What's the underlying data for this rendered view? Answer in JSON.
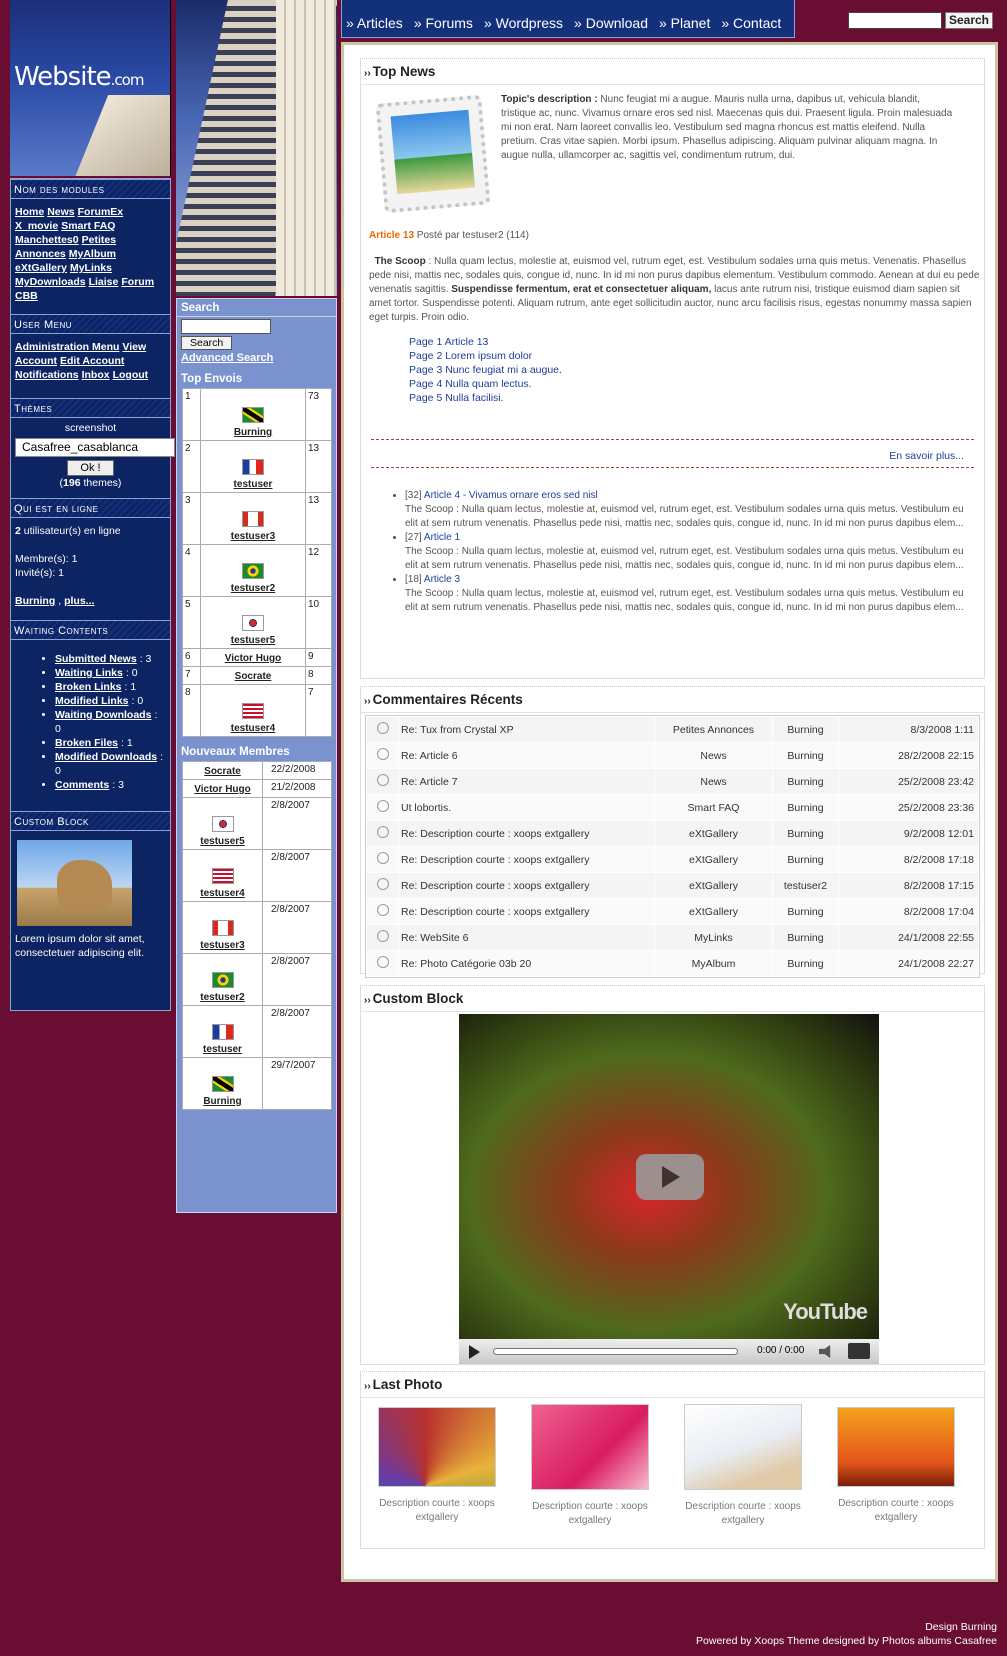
{
  "site": {
    "logo_text": "Website",
    "logo_suffix": ".com"
  },
  "nav": {
    "items": [
      "» Articles",
      "» Forums",
      "» Wordpress",
      "» Download",
      "» Planet",
      "» Contact"
    ]
  },
  "top_search": {
    "button": "Search",
    "value": ""
  },
  "modules": {
    "title": "Nom des modules",
    "links": [
      "Home",
      "News",
      "ForumEx",
      "X_movie",
      "Smart FAQ",
      "Manchettes0",
      "Petites Annonces",
      "MyAlbum",
      "eXtGallery",
      "MyLinks",
      "MyDownloads",
      "Liaise",
      "Forum",
      "CBB"
    ]
  },
  "usermenu": {
    "title": "User Menu",
    "links": [
      "Administration Menu",
      "View Account",
      "Edit Account",
      "Notifications",
      "Inbox",
      "Logout"
    ]
  },
  "themes": {
    "title": "Thèmes",
    "screenshot": "screenshot",
    "selected": "Casafree_casablanca",
    "ok": "Ok !",
    "count_prefix": "(",
    "count": "196",
    "count_suffix": " themes)"
  },
  "online": {
    "title": "Qui est en ligne",
    "users": "2",
    "users_text": " utilisateur(s) en ligne",
    "members": "Membre(s): 1",
    "guests": "Invité(s): 1",
    "link1": "Burning",
    "link2": "plus..."
  },
  "waiting": {
    "title": "Waiting Contents",
    "items": [
      {
        "label": "Submitted News",
        "count": ": 3"
      },
      {
        "label": "Waiting Links",
        "count": ": 0"
      },
      {
        "label": "Broken Links",
        "count": ": 1"
      },
      {
        "label": "Modified Links",
        "count": ": 0"
      },
      {
        "label": "Waiting Downloads",
        "count": ": 0"
      },
      {
        "label": "Broken Files",
        "count": ": 1"
      },
      {
        "label": "Modified Downloads",
        "count": ": 0"
      },
      {
        "label": "Comments",
        "count": ": 3"
      }
    ]
  },
  "custom_left": {
    "title": "Custom Block",
    "text": "Lorem ipsum dolor sit amet, consectetuer adipiscing elit."
  },
  "search_block": {
    "title": "Search",
    "button": "Search",
    "advanced": "Advanced Search"
  },
  "top_envois": {
    "title": "Top Envois",
    "rows": [
      {
        "rank": "1",
        "user": "Burning",
        "count": "73",
        "flag": "jamaica"
      },
      {
        "rank": "2",
        "user": "testuser",
        "count": "13",
        "flag": "france"
      },
      {
        "rank": "3",
        "user": "testuser3",
        "count": "13",
        "flag": "canada"
      },
      {
        "rank": "4",
        "user": "testuser2",
        "count": "12",
        "flag": "brazil"
      },
      {
        "rank": "5",
        "user": "testuser5",
        "count": "10",
        "flag": "korea"
      },
      {
        "rank": "6",
        "user": "Victor Hugo",
        "count": "9",
        "flag": ""
      },
      {
        "rank": "7",
        "user": "Socrate",
        "count": "8",
        "flag": ""
      },
      {
        "rank": "8",
        "user": "testuser4",
        "count": "7",
        "flag": "usa"
      }
    ]
  },
  "nouveaux": {
    "title": "Nouveaux Membres",
    "rows": [
      {
        "user": "Socrate",
        "date": "22/2/2008",
        "flag": ""
      },
      {
        "user": "Victor Hugo",
        "date": "21/2/2008",
        "flag": ""
      },
      {
        "user": "testuser5",
        "date": "2/8/2007",
        "flag": "korea"
      },
      {
        "user": "testuser4",
        "date": "2/8/2007",
        "flag": "usa"
      },
      {
        "user": "testuser3",
        "date": "2/8/2007",
        "flag": "canada"
      },
      {
        "user": "testuser2",
        "date": "2/8/2007",
        "flag": "brazil"
      },
      {
        "user": "testuser",
        "date": "2/8/2007",
        "flag": "france"
      },
      {
        "user": "Burning",
        "date": "29/7/2007",
        "flag": "jamaica"
      }
    ]
  },
  "topnews": {
    "title": "Top News",
    "topic_label": "Topic's description :",
    "topic_text": " Nunc feugiat mi a augue. Mauris nulla urna, dapibus ut, vehicula blandit, tristique ac, nunc. Vivamus ornare eros sed nisl. Maecenas quis dui. Praesent ligula. Proin malesuada mi non erat. Nam laoreet convallis leo. Vestibulum sed magna rhoncus est mattis eleifend. Nulla pretium. Cras vitae sapien. Morbi ipsum. Phasellus adipiscing. Aliquam pulvinar aliquam magna. In augue nulla, ullamcorper ac, sagittis vel, condimentum rutrum, dui.",
    "article_title": "Article 13",
    "article_meta": " Posté par testuser2 (114)",
    "scoop_label": "The Scoop",
    "scoop_text": " : Nulla quam lectus, molestie at, euismod vel, rutrum eget, est. Vestibulum sodales urna quis metus. Venenatis. Phasellus pede nisi, mattis nec, sodales quis, congue id, nunc. In id mi non purus dapibus elementum. Vestibulum commodo. Aenean at dui eu pede venenatis sagittis. ",
    "scoop_bold": "Suspendisse fermentum, erat et consectetuer aliquam,",
    "scoop_tail": " lacus ante rutrum nisi, tristique euismod diam sapien sit amet tortor. Suspendisse potenti. Aliquam rutrum, ante eget sollicitudin auctor, nunc arcu facilisis risus, egestas nonummy massa sapien eget turpis. Proin odio.",
    "pages": [
      "Page 1 Article 13",
      "Page 2 Lorem ipsum dolor",
      "Page 3 Nunc feugiat mi a augue.",
      "Page 4 Nulla quam lectus.",
      "Page 5 Nulla facilisi."
    ],
    "more": "En savoir plus...",
    "list": [
      {
        "id": "[32]",
        "title": "Article 4 - Vivamus ornare eros sed nisl",
        "text": "The Scoop : Nulla quam lectus, molestie at, euismod vel, rutrum eget, est. Vestibulum sodales urna quis metus. Vestibulum eu elit at sem rutrum venenatis. Phasellus pede nisi, mattis nec, sodales quis, congue id, nunc. In id mi non purus dapibus elem..."
      },
      {
        "id": "[27]",
        "title": "Article 1",
        "text": "The Scoop : Nulla quam lectus, molestie at, euismod vel, rutrum eget, est. Vestibulum sodales urna quis metus. Vestibulum eu elit at sem rutrum venenatis. Phasellus pede nisi, mattis nec, sodales quis, congue id, nunc. In id mi non purus dapibus elem..."
      },
      {
        "id": "[18]",
        "title": "Article 3",
        "text": "The Scoop : Nulla quam lectus, molestie at, euismod vel, rutrum eget, est. Vestibulum sodales urna quis metus. Vestibulum eu elit at sem rutrum venenatis. Phasellus pede nisi, mattis nec, sodales quis, congue id, nunc. In id mi non purus dapibus elem..."
      }
    ]
  },
  "comments": {
    "title": "Commentaires Récents",
    "rows": [
      {
        "subject": "Re: Tux from Crystal XP",
        "module": "Petites Annonces",
        "user": "Burning",
        "date": "8/3/2008 1:11"
      },
      {
        "subject": "Re: Article 6",
        "module": "News",
        "user": "Burning",
        "date": "28/2/2008 22:15"
      },
      {
        "subject": "Re: Article 7",
        "module": "News",
        "user": "Burning",
        "date": "25/2/2008 23:42"
      },
      {
        "subject": "Ut lobortis.",
        "module": "Smart FAQ",
        "user": "Burning",
        "date": "25/2/2008 23:36"
      },
      {
        "subject": "Re: Description courte : xoops extgallery",
        "module": "eXtGallery",
        "user": "Burning",
        "date": "9/2/2008 12:01"
      },
      {
        "subject": "Re: Description courte : xoops extgallery",
        "module": "eXtGallery",
        "user": "Burning",
        "date": "8/2/2008 17:18"
      },
      {
        "subject": "Re: Description courte : xoops extgallery",
        "module": "eXtGallery",
        "user": "testuser2",
        "date": "8/2/2008 17:15"
      },
      {
        "subject": "Re: Description courte : xoops extgallery",
        "module": "eXtGallery",
        "user": "Burning",
        "date": "8/2/2008 17:04"
      },
      {
        "subject": "Re: WebSite 6",
        "module": "MyLinks",
        "user": "Burning",
        "date": "24/1/2008 22:55"
      },
      {
        "subject": "Re: Photo Catégorie 03b 20",
        "module": "MyAlbum",
        "user": "Burning",
        "date": "24/1/2008 22:27"
      }
    ]
  },
  "custom_main": {
    "title": "Custom Block",
    "time": "0:00 / 0:00",
    "brand": "YouTube"
  },
  "photos": {
    "title": "Last Photo",
    "items": [
      {
        "caption": "Description courte : xoops extgallery"
      },
      {
        "caption": "Description courte : xoops extgallery"
      },
      {
        "caption": "Description courte : xoops extgallery"
      },
      {
        "caption": "Description courte : xoops extgallery"
      }
    ]
  },
  "footer": {
    "line1": "Design Burning",
    "line2": "Powered by Xoops Theme designed by Photos albums Casafree"
  },
  "colors": {
    "background": "#6a0d32",
    "left_panel": "#0d2463",
    "middle_panel": "#7a93cf",
    "accent_orange": "#e86a00"
  }
}
